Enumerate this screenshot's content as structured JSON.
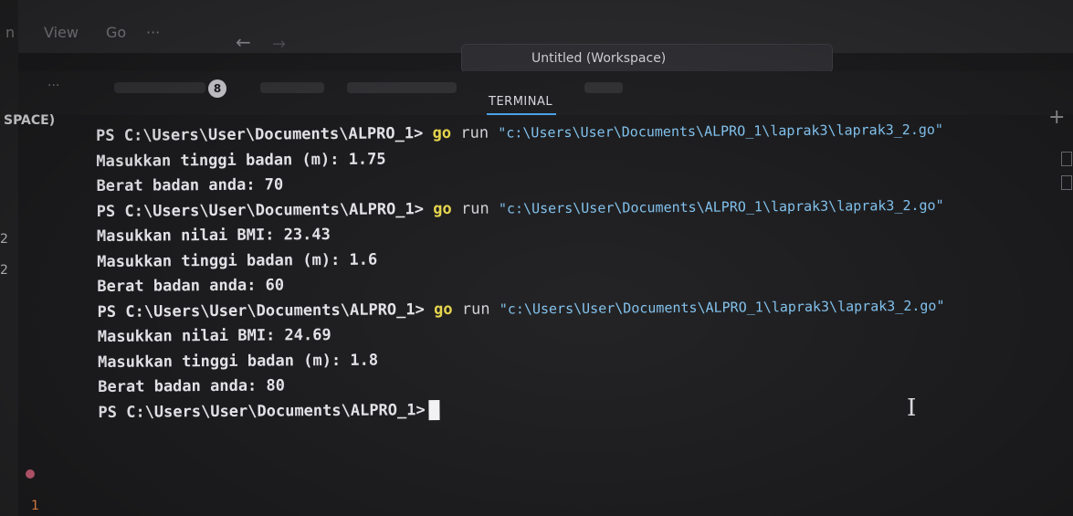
{
  "menubar": {
    "items": [
      "n",
      "View",
      "Go",
      "···"
    ],
    "back_arrow": "←",
    "forward_arrow": "→",
    "title": "Untitled (Workspace)"
  },
  "panel": {
    "more": "···",
    "problems_count": "8",
    "active_tab": "TERMINAL",
    "new_terminal": "+"
  },
  "sidebar": {
    "label": "SPACE)",
    "fragment_1": "2",
    "fragment_2": "2",
    "badge_number": "1"
  },
  "terminal": {
    "prompt": "PS C:\\Users\\User\\Documents\\ALPRO_1>",
    "cmd_go": "go",
    "cmd_run": "run",
    "cmd_path": "\"c:\\Users\\User\\Documents\\ALPRO_1\\laprak3\\laprak3_2.go\"",
    "lines": [
      "Masukkan tinggi badan (m): 1.75",
      "Berat badan anda: 70",
      "Masukkan nilai BMI: 23.43",
      "Masukkan tinggi badan (m): 1.6",
      "Berat badan anda: 60",
      "Masukkan nilai BMI: 24.69",
      "Masukkan tinggi badan (m): 1.8",
      "Berat badan anda: 80"
    ]
  },
  "colors": {
    "background": "#1b1b1d",
    "go_keyword": "#e6d44a",
    "path_string": "#7fc0ec",
    "tab_underline": "#4aa0e8"
  }
}
